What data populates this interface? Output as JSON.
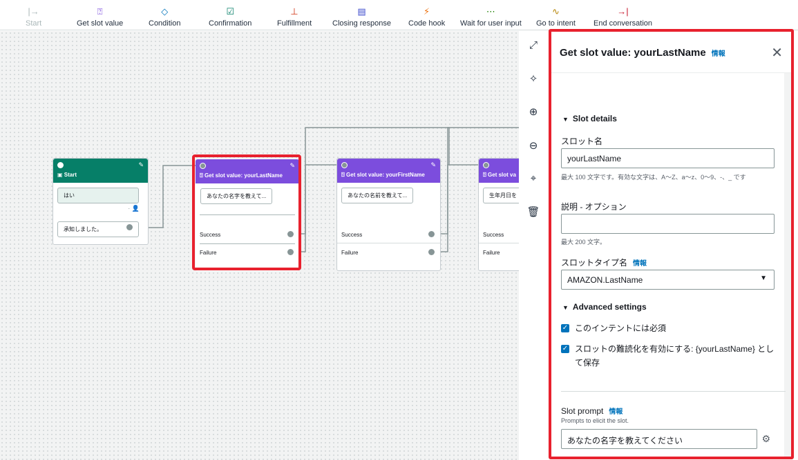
{
  "toolbar": {
    "items": [
      {
        "label": "Start",
        "icon": "start-icon"
      },
      {
        "label": "Get slot value",
        "icon": "question-box-icon"
      },
      {
        "label": "Condition",
        "icon": "diamond-icon"
      },
      {
        "label": "Confirmation",
        "icon": "check-box-icon"
      },
      {
        "label": "Fulfillment",
        "icon": "fulfillment-icon"
      },
      {
        "label": "Closing response",
        "icon": "document-icon"
      },
      {
        "label": "Code hook",
        "icon": "plug-icon"
      },
      {
        "label": "Wait for user input",
        "icon": "ellipsis-box-icon"
      },
      {
        "label": "Go to intent",
        "icon": "route-icon"
      },
      {
        "label": "End conversation",
        "icon": "end-arrow-icon"
      }
    ]
  },
  "canvas": {
    "start_node": {
      "title": "Start",
      "reply_yes": "はい",
      "ack": "承知しました。"
    },
    "node_last": {
      "title": "Get slot value: yourLastName",
      "prompt": "あなたの名字を教えて...",
      "success": "Success",
      "failure": "Failure"
    },
    "node_first": {
      "title": "Get slot value: yourFirstName",
      "prompt": "あなたの名前を教えて...",
      "success": "Success",
      "failure": "Failure"
    },
    "node_birth": {
      "title": "Get slot va",
      "prompt": "生年月日を",
      "success": "Success",
      "failure": "Failure"
    }
  },
  "panel": {
    "title": "Get slot value: yourLastName",
    "info": "情報",
    "slot_details": "Slot details",
    "slot_name_label": "スロット名",
    "slot_name_value": "yourLastName",
    "slot_name_hint": "最大 100 文字です。有効な文字は、A〜Z、a〜z、0〜9、-、_ です",
    "description_label": "説明 - オプション",
    "description_value": "",
    "description_hint": "最大 200 文字。",
    "slot_type_label": "スロットタイプ名",
    "slot_type_info": "情報",
    "slot_type_value": "AMAZON.LastName",
    "advanced": "Advanced settings",
    "required_label": "このインテントには必須",
    "obfuscation_label": "スロットの難読化を有効にする: {yourLastName} として保存",
    "slot_prompt_label": "Slot prompt",
    "slot_prompt_info": "情報",
    "slot_prompt_hint": "Prompts to elicit the slot.",
    "slot_prompt_value": "あなたの名字を教えてください"
  },
  "colors": {
    "selected": "#e8212e",
    "purple": "#7c4ddd",
    "green": "#067f68",
    "link": "#0073bb"
  }
}
